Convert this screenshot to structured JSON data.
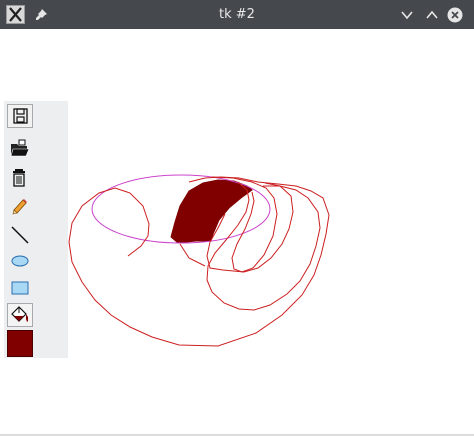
{
  "window": {
    "title": "tk #2",
    "titlebar_color": "#45484c",
    "icons": [
      "app-icon-x",
      "pin-icon",
      "minimize-chevron-down-icon",
      "maximize-chevron-up-icon",
      "close-icon"
    ]
  },
  "toolbar": {
    "tools": [
      {
        "name": "save",
        "icon": "floppy-disk-icon"
      },
      {
        "name": "open",
        "icon": "open-folder-icon"
      },
      {
        "name": "delete",
        "icon": "trash-can-icon"
      },
      {
        "name": "pencil",
        "icon": "pencil-icon"
      },
      {
        "name": "line",
        "icon": "line-icon"
      },
      {
        "name": "oval",
        "icon": "oval-icon"
      },
      {
        "name": "rectangle",
        "icon": "rectangle-icon"
      },
      {
        "name": "fill",
        "icon": "paint-bucket-icon",
        "selected": true
      }
    ],
    "current_color": "#800000"
  },
  "canvas": {
    "background": "#ffffff",
    "stroke_colors": {
      "freehand": "#cc1f1f",
      "oval": "#cc44cc",
      "fill": "#800000"
    }
  }
}
